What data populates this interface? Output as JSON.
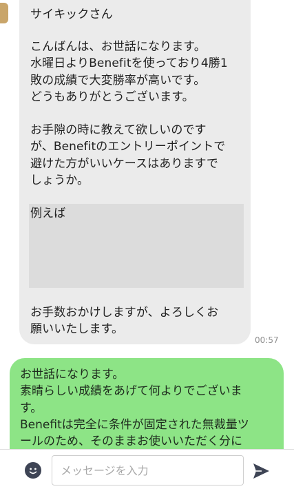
{
  "incoming": {
    "para1": "サイキックさん",
    "para2": "こんばんは、お世話になります。\n水曜日よりBenefitを使っており4勝1\n敗の成績で大変勝率が高いです。\nどうもありがとうございます。",
    "para3": "お手隙の時に教えて欲しいのです\nが、Benefitのエントリーポイントで\n避けた方がいいケースはありますで\nしょうか。",
    "para4": "例えば",
    "para5": "お手数おかけしますが、よろしくお\n願いいたします。",
    "timestamp": "00:57"
  },
  "outgoing": {
    "text": "お世話になります。\n素晴らしい成績をあげて何よりでございま\nす。\nBenefitは完全に条件が固定された無裁量ツ\nールのため、そのままお使いいただく分に"
  },
  "composer": {
    "placeholder": "メッセージを入力",
    "emoji_icon": "emoji-icon",
    "send_icon": "send-icon"
  },
  "colors": {
    "incoming_bubble": "#ebebeb",
    "outgoing_bubble": "#8de486",
    "redacted_block": "#dcdcdc"
  }
}
